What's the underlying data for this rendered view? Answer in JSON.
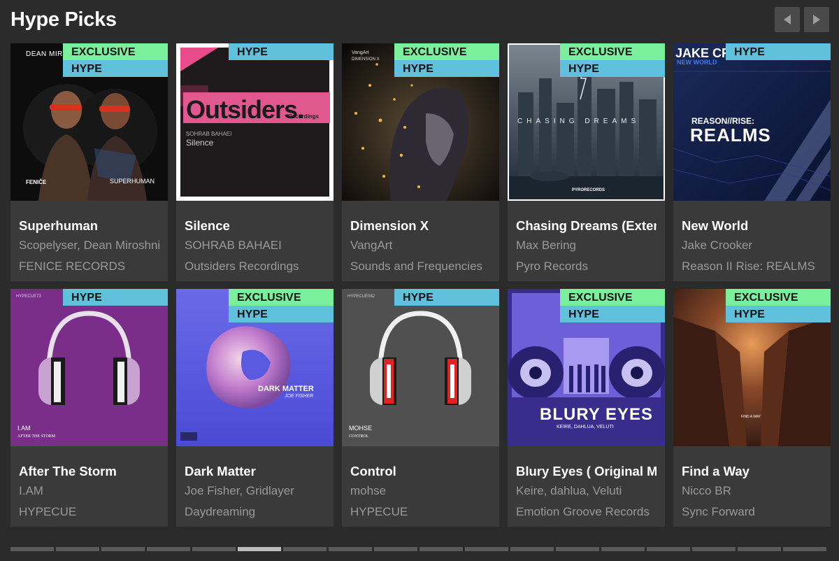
{
  "section": {
    "title": "Hype Picks",
    "prev_icon": "chevron-left-icon",
    "next_icon": "chevron-right-icon"
  },
  "badges": {
    "exclusive": "EXCLUSIVE",
    "hype": "HYPE"
  },
  "tracks": [
    {
      "title": "Superhuman",
      "artist": "Scopelyser, Dean Miroshnichenko",
      "label": "FENICE RECORDS",
      "exclusive": true,
      "hype": true,
      "cover_text": {
        "top": "DEAN MIROS",
        "bottom_left": "FENIČE",
        "bottom_right": "SUPERHUMAN"
      }
    },
    {
      "title": "Silence",
      "artist": "SOHRAB BAHAEI",
      "label": "Outsiders Recordings",
      "exclusive": false,
      "hype": true,
      "cover_text": {
        "logo": "Outsiders.",
        "logo_sub": "Recordings",
        "artist": "SOHRAB BAHAEI",
        "track": "Silence"
      }
    },
    {
      "title": "Dimension X",
      "artist": "VangArt",
      "label": "Sounds and Frequencies",
      "exclusive": true,
      "hype": true,
      "cover_text": {
        "top": "VangArt",
        "top2": "DIMENSION X"
      }
    },
    {
      "title": "Chasing Dreams (Extended Mix)",
      "artist": "Max Bering",
      "label": "Pyro Records",
      "exclusive": true,
      "hype": true,
      "cover_text": {
        "center": "CHASING DREAMS",
        "bottom": "PYRORECORDS"
      }
    },
    {
      "title": "New World",
      "artist": "Jake Crooker",
      "label": "Reason II Rise: REALMS",
      "exclusive": false,
      "hype": true,
      "cover_text": {
        "top": "JAKE CR",
        "top2": "NEW WORLD",
        "center": "REASON//RISE:",
        "center2": "REALMS"
      }
    },
    {
      "title": "After The Storm",
      "artist": "I.AM",
      "label": "HYPECUE",
      "exclusive": false,
      "hype": true,
      "cover_text": {
        "top": "HYPECUE73",
        "artist": "I.AM",
        "track": "AFTER THE STORM"
      }
    },
    {
      "title": "Dark Matter",
      "artist": "Joe Fisher, Gridlayer",
      "label": "Daydreaming",
      "exclusive": true,
      "hype": true,
      "cover_text": {
        "center": "DARK MATTER",
        "center2": "JOE FISHER"
      }
    },
    {
      "title": "Control",
      "artist": "mohse",
      "label": "HYPECUE",
      "exclusive": false,
      "hype": true,
      "cover_text": {
        "top": "HYPECUE082",
        "artist": "MOHSE",
        "track": "CONTROL"
      }
    },
    {
      "title": "Blury Eyes ( Original Mix )",
      "artist": "Keire, dahlua, Veluti",
      "label": "Emotion Groove Records",
      "exclusive": true,
      "hype": true,
      "cover_text": {
        "center": "BLURY EYES",
        "center2": "KEIRE, DAHLUA, VELUTI"
      }
    },
    {
      "title": "Find a Way",
      "artist": "Nicco BR",
      "label": "Sync Forward",
      "exclusive": true,
      "hype": true,
      "cover_text": {
        "center": "FIND A WAY"
      }
    }
  ],
  "pager": {
    "count": 18,
    "active_index": 5
  }
}
